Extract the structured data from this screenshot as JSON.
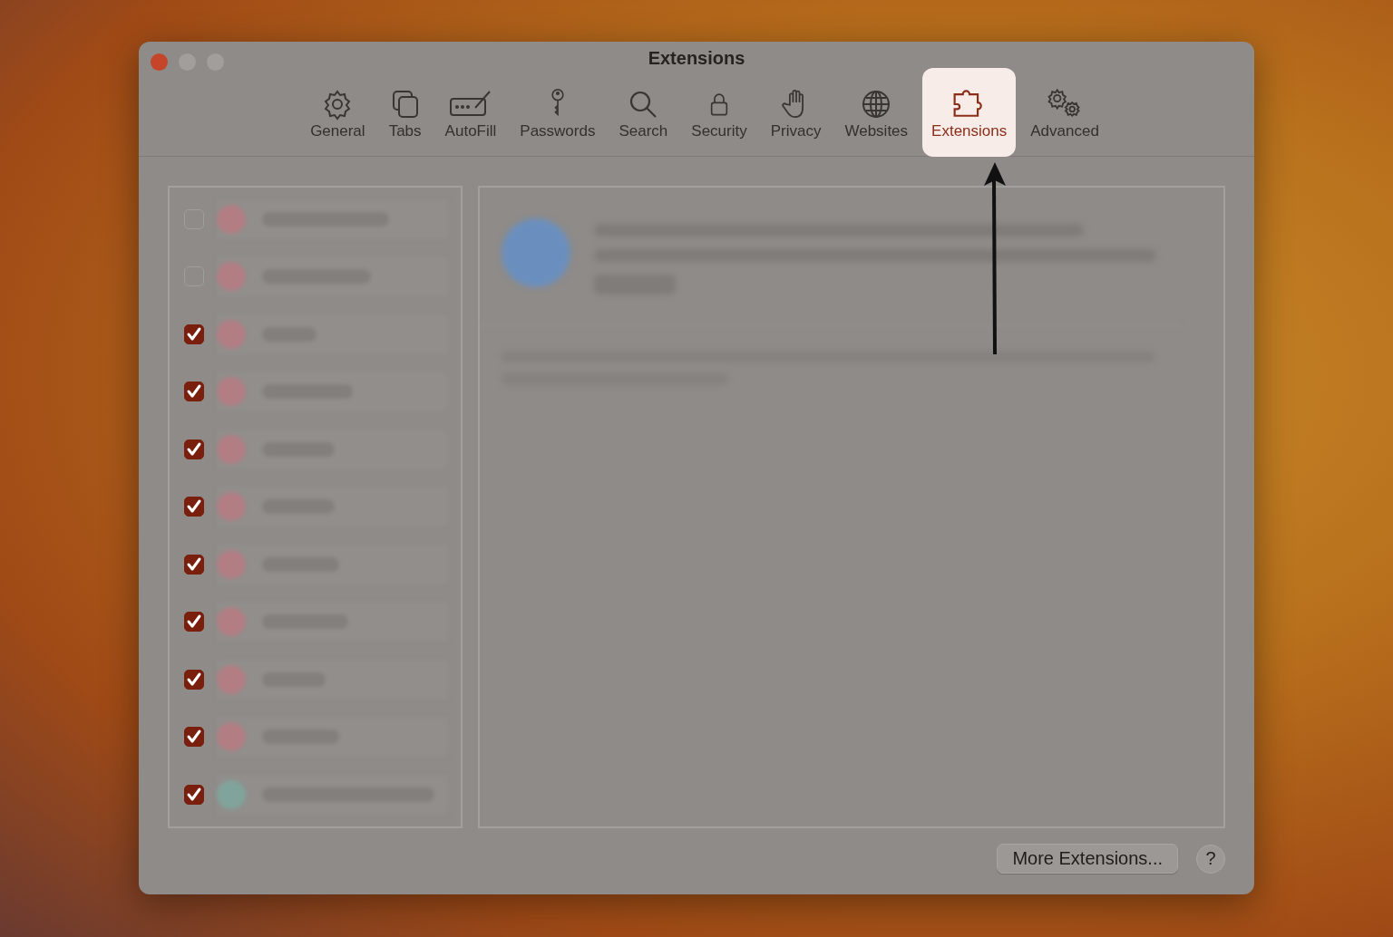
{
  "window": {
    "title": "Extensions"
  },
  "tabs": [
    {
      "label": "General",
      "selected": false
    },
    {
      "label": "Tabs",
      "selected": false
    },
    {
      "label": "AutoFill",
      "selected": false
    },
    {
      "label": "Passwords",
      "selected": false
    },
    {
      "label": "Search",
      "selected": false
    },
    {
      "label": "Security",
      "selected": false
    },
    {
      "label": "Privacy",
      "selected": false
    },
    {
      "label": "Websites",
      "selected": false
    },
    {
      "label": "Extensions",
      "selected": true
    },
    {
      "label": "Advanced",
      "selected": false
    }
  ],
  "extensions": [
    {
      "checked": false,
      "color": "#b27e84"
    },
    {
      "checked": false,
      "color": "#b27e84"
    },
    {
      "checked": true,
      "color": "#b27e84"
    },
    {
      "checked": true,
      "color": "#b27e84"
    },
    {
      "checked": true,
      "color": "#b27e84"
    },
    {
      "checked": true,
      "color": "#b27e84"
    },
    {
      "checked": true,
      "color": "#b27e84"
    },
    {
      "checked": true,
      "color": "#b27e84"
    },
    {
      "checked": true,
      "color": "#b27e84"
    },
    {
      "checked": true,
      "color": "#b27e84"
    },
    {
      "checked": true,
      "color": "#80a49b"
    }
  ],
  "buttons": {
    "more": "More Extensions...",
    "help": "?"
  }
}
